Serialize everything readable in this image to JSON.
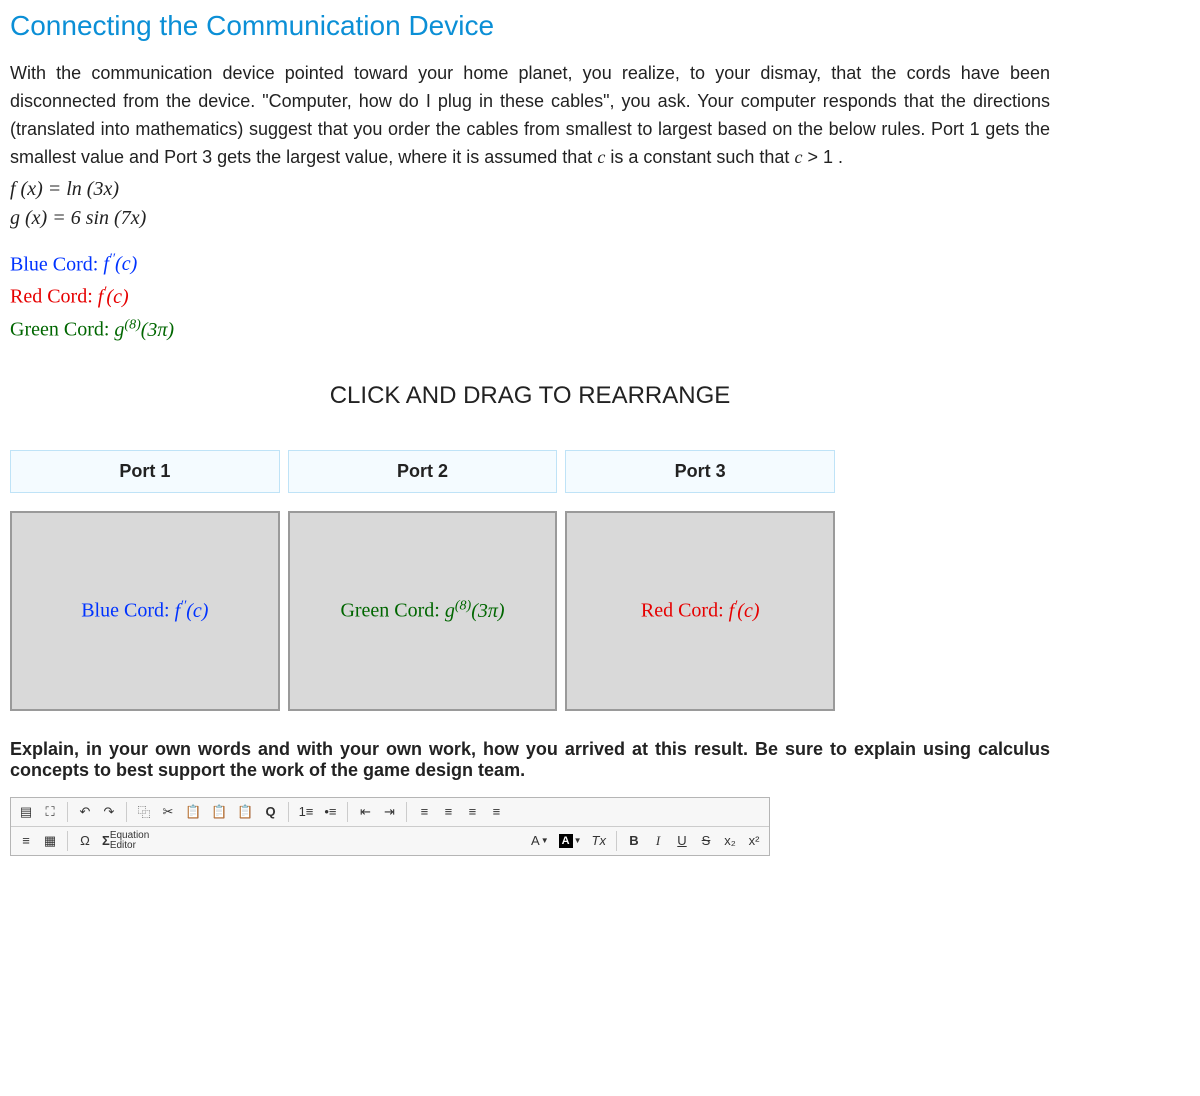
{
  "heading": "Connecting the Communication Device",
  "intro": {
    "p1a": "With the communication device pointed toward your home planet, you realize, to your dismay, that the cords have been disconnected from the device. \"Computer, how do I plug in these cables\", you ask. Your computer responds that the directions (translated into mathematics) suggest that you order the cables from smallest to largest based on the below rules. Port 1 gets the smallest value and Port 3 gets the largest value, where it is assumed that ",
    "c1": "c",
    "p1b": " is a constant such that ",
    "c2": "c",
    "gt": " > 1",
    "p1c": "."
  },
  "functions": {
    "f": "f (x) = ln (3x)",
    "g": "g (x) = 6 sin (7x)"
  },
  "cords": {
    "blue_label": "Blue Cord: ",
    "blue_expr_a": "f",
    "blue_expr_sup": "′′",
    "blue_expr_b": "(c)",
    "red_label": "Red Cord: ",
    "red_expr_a": "f",
    "red_expr_sup": "′",
    "red_expr_b": "(c)",
    "green_label": "Green Cord: ",
    "green_expr_a": "g",
    "green_expr_sup": "(8)",
    "green_expr_b": "(3π)"
  },
  "instruction": "CLICK AND DRAG TO REARRANGE",
  "ports": [
    "Port 1",
    "Port 2",
    "Port 3"
  ],
  "slots": {
    "slot1": {
      "color": "blue",
      "label": "Blue Cord: ",
      "a": "f",
      "sup": "′′",
      "b": "(c)"
    },
    "slot2": {
      "color": "green",
      "label": "Green Cord: ",
      "a": "g",
      "sup": "(8)",
      "b": "(3π)"
    },
    "slot3": {
      "color": "red",
      "label": "Red Cord: ",
      "a": "f",
      "sup": "′",
      "b": "(c)"
    }
  },
  "explain_prompt": "Explain, in your own words and with your own work, how you arrived at this result. Be sure to explain using calculus concepts to best support the work of the game design team.",
  "toolbar": {
    "source": "▤",
    "fullscreen": "⛶",
    "undo": "↶",
    "redo": "↷",
    "copy": "⿻",
    "cut": "✂",
    "paste": "📋",
    "paste_text": "📋",
    "paste_word": "📋",
    "find": "Q",
    "ol": "1≡",
    "ul": "•≡",
    "outdent": "⇤",
    "indent": "⇥",
    "align_l": "≡",
    "align_c": "≡",
    "align_r": "≡",
    "align_j": "≡",
    "menu": "≡",
    "table": "▦",
    "omega": "Ω",
    "sigma": "Σ",
    "eq_label_top": "Equation",
    "eq_label_bot": "Editor",
    "textcolor": "A",
    "bgcolor_box": "A",
    "clear": "Tx",
    "bold": "B",
    "italic": "I",
    "underline": "U",
    "strike": "S",
    "sub": "x₂",
    "sup2": "x²"
  }
}
